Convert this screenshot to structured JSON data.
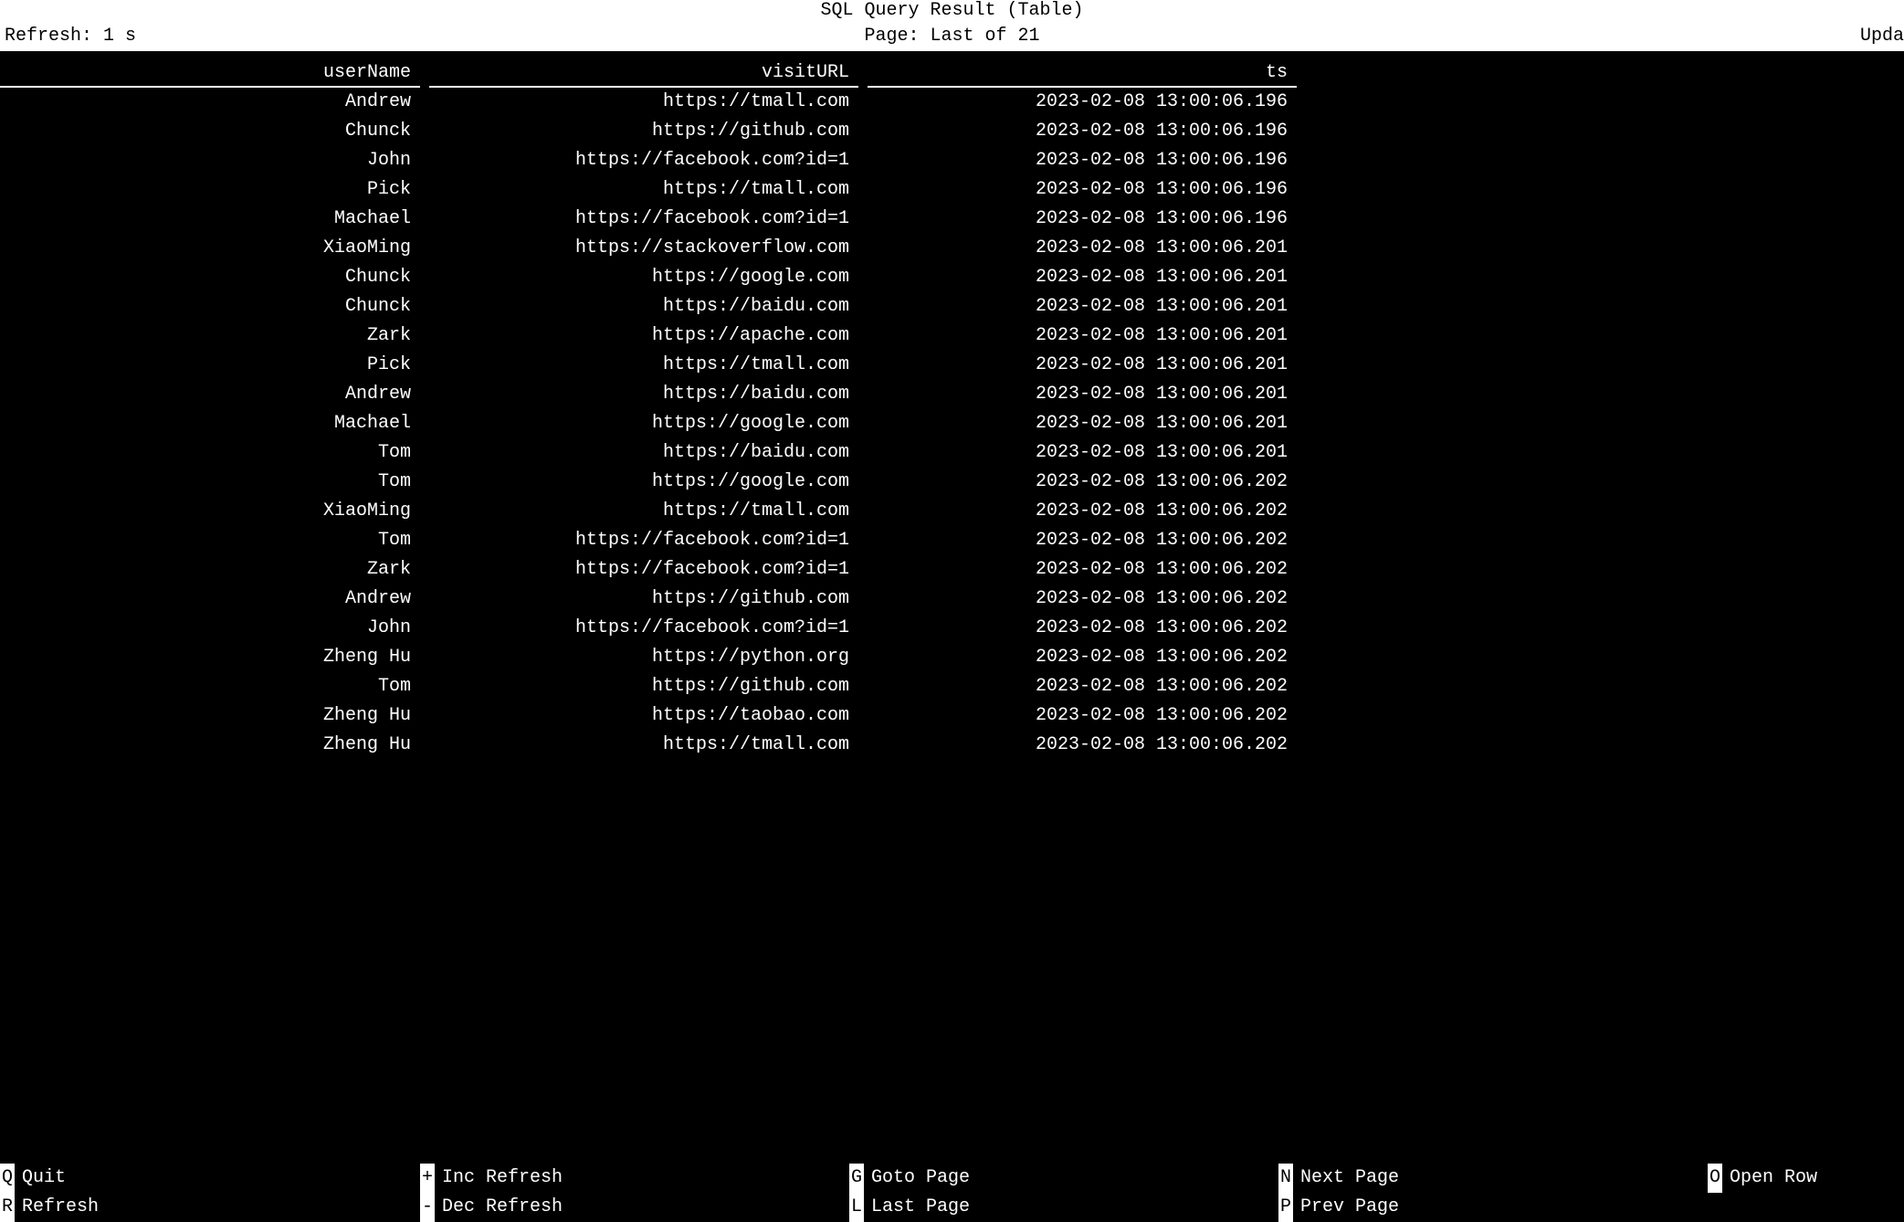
{
  "header": {
    "title": "SQL Query Result (Table)",
    "refresh": "Refresh: 1 s",
    "page": "Page: Last of 21",
    "upda": "Upda"
  },
  "columns": {
    "userName": "userName",
    "visitURL": "visitURL",
    "ts": "ts"
  },
  "rows": [
    {
      "userName": "Andrew",
      "visitURL": "https://tmall.com",
      "ts": "2023-02-08 13:00:06.196"
    },
    {
      "userName": "Chunck",
      "visitURL": "https://github.com",
      "ts": "2023-02-08 13:00:06.196"
    },
    {
      "userName": "John",
      "visitURL": "https://facebook.com?id=1",
      "ts": "2023-02-08 13:00:06.196"
    },
    {
      "userName": "Pick",
      "visitURL": "https://tmall.com",
      "ts": "2023-02-08 13:00:06.196"
    },
    {
      "userName": "Machael",
      "visitURL": "https://facebook.com?id=1",
      "ts": "2023-02-08 13:00:06.196"
    },
    {
      "userName": "XiaoMing",
      "visitURL": "https://stackoverflow.com",
      "ts": "2023-02-08 13:00:06.201"
    },
    {
      "userName": "Chunck",
      "visitURL": "https://google.com",
      "ts": "2023-02-08 13:00:06.201"
    },
    {
      "userName": "Chunck",
      "visitURL": "https://baidu.com",
      "ts": "2023-02-08 13:00:06.201"
    },
    {
      "userName": "Zark",
      "visitURL": "https://apache.com",
      "ts": "2023-02-08 13:00:06.201"
    },
    {
      "userName": "Pick",
      "visitURL": "https://tmall.com",
      "ts": "2023-02-08 13:00:06.201"
    },
    {
      "userName": "Andrew",
      "visitURL": "https://baidu.com",
      "ts": "2023-02-08 13:00:06.201"
    },
    {
      "userName": "Machael",
      "visitURL": "https://google.com",
      "ts": "2023-02-08 13:00:06.201"
    },
    {
      "userName": "Tom",
      "visitURL": "https://baidu.com",
      "ts": "2023-02-08 13:00:06.201"
    },
    {
      "userName": "Tom",
      "visitURL": "https://google.com",
      "ts": "2023-02-08 13:00:06.202"
    },
    {
      "userName": "XiaoMing",
      "visitURL": "https://tmall.com",
      "ts": "2023-02-08 13:00:06.202"
    },
    {
      "userName": "Tom",
      "visitURL": "https://facebook.com?id=1",
      "ts": "2023-02-08 13:00:06.202"
    },
    {
      "userName": "Zark",
      "visitURL": "https://facebook.com?id=1",
      "ts": "2023-02-08 13:00:06.202"
    },
    {
      "userName": "Andrew",
      "visitURL": "https://github.com",
      "ts": "2023-02-08 13:00:06.202"
    },
    {
      "userName": "John",
      "visitURL": "https://facebook.com?id=1",
      "ts": "2023-02-08 13:00:06.202"
    },
    {
      "userName": "Zheng Hu",
      "visitURL": "https://python.org",
      "ts": "2023-02-08 13:00:06.202"
    },
    {
      "userName": "Tom",
      "visitURL": "https://github.com",
      "ts": "2023-02-08 13:00:06.202"
    },
    {
      "userName": "Zheng Hu",
      "visitURL": "https://taobao.com",
      "ts": "2023-02-08 13:00:06.202"
    },
    {
      "userName": "Zheng Hu",
      "visitURL": "https://tmall.com",
      "ts": "2023-02-08 13:00:06.202"
    }
  ],
  "footer": {
    "row1": [
      {
        "key": "Q",
        "label": "Quit"
      },
      {
        "key": "+",
        "label": "Inc Refresh"
      },
      {
        "key": "G",
        "label": "Goto Page"
      },
      {
        "key": "N",
        "label": "Next Page"
      },
      {
        "key": "O",
        "label": "Open Row"
      }
    ],
    "row2": [
      {
        "key": "R",
        "label": "Refresh"
      },
      {
        "key": "-",
        "label": "Dec Refresh"
      },
      {
        "key": "L",
        "label": "Last Page"
      },
      {
        "key": "P",
        "label": "Prev Page"
      },
      {
        "key": "",
        "label": ""
      }
    ]
  }
}
